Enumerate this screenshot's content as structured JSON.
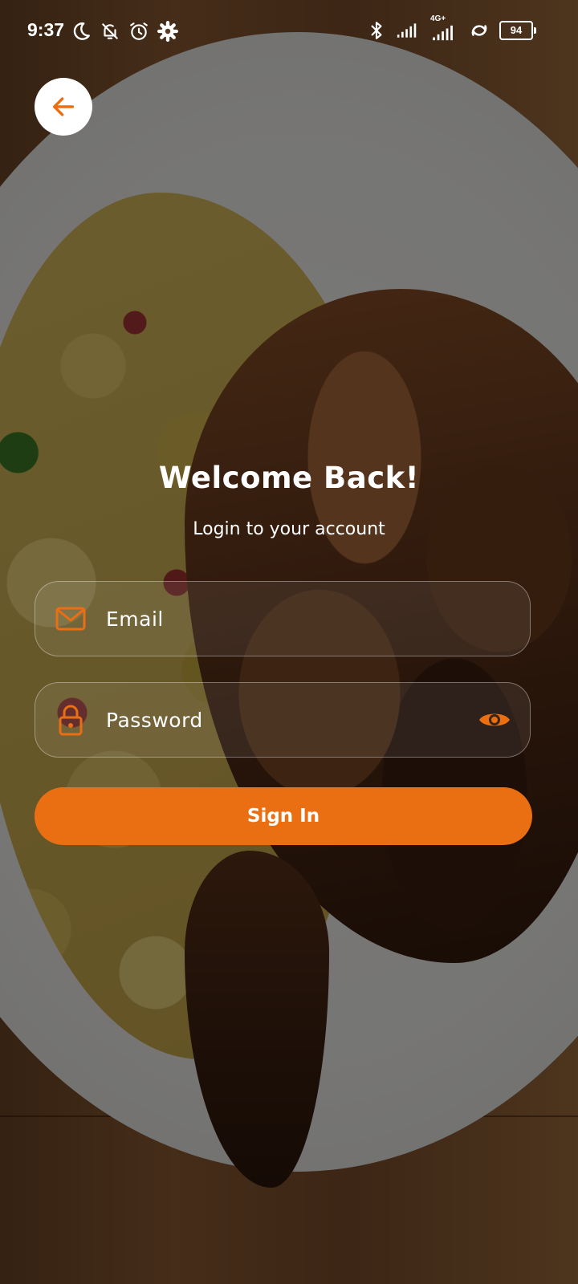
{
  "status_bar": {
    "time": "9:37",
    "network_label": "4G+",
    "battery_level": "94",
    "left_icons": [
      "moon-icon",
      "bell-off-icon",
      "alarm-icon",
      "gear-icon"
    ],
    "right_icons": [
      "bluetooth-icon",
      "signal-icon",
      "signal-4g-icon",
      "hotspot-icon",
      "battery-icon"
    ]
  },
  "header": {
    "back_icon": "arrow-left-icon"
  },
  "login": {
    "title": "Welcome Back!",
    "subtitle": "Login to your account",
    "email": {
      "icon": "mail-icon",
      "placeholder": "Email",
      "value": ""
    },
    "password": {
      "icon": "lock-icon",
      "placeholder": "Password",
      "value": "",
      "toggle_icon": "eye-icon"
    },
    "submit_label": "Sign In"
  },
  "colors": {
    "accent": "#ea6f12",
    "text": "#ffffff",
    "overlay": "rgba(0,0,0,0.5)"
  }
}
